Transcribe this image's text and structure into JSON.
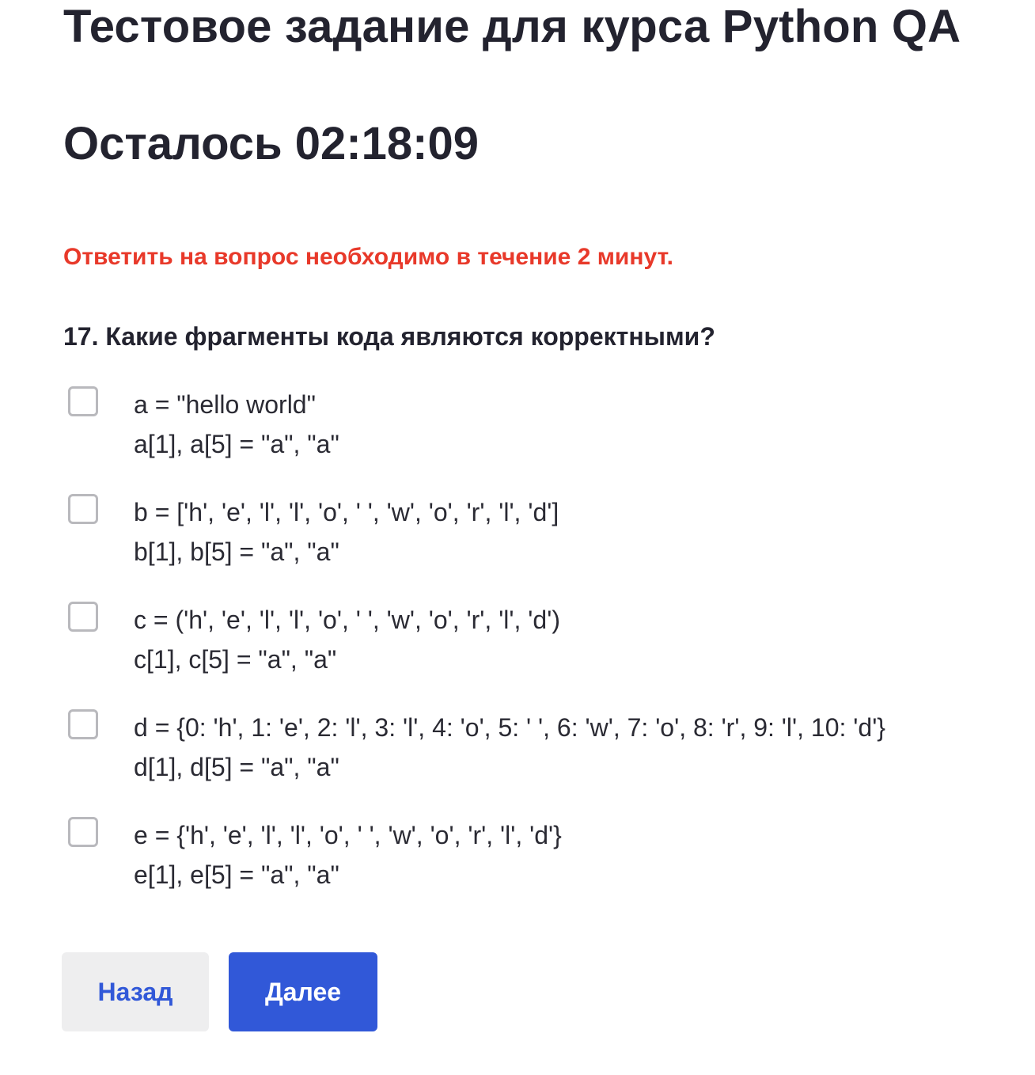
{
  "header": {
    "title": "Тестовое задание для курса Python QA",
    "timer": "Осталось 02:18:09"
  },
  "warning": "Ответить на вопрос необходимо в течение 2 минут.",
  "question": {
    "text": "17. Какие фрагменты кода являются корректными?",
    "options": [
      {
        "line1": "a = \"hello world\"",
        "line2": "a[1], a[5] = \"a\", \"a\"",
        "checked": false
      },
      {
        "line1": "b = ['h', 'e', 'l', 'l', 'o', ' ', 'w', 'o', 'r', 'l', 'd']",
        "line2": "b[1], b[5] = \"a\", \"a\"",
        "checked": false
      },
      {
        "line1": "c = ('h', 'e', 'l', 'l', 'o', ' ', 'w', 'o', 'r', 'l', 'd')",
        "line2": "c[1], c[5] = \"a\", \"a\"",
        "checked": false
      },
      {
        "line1": "d = {0: 'h', 1: 'e', 2: 'l', 3: 'l', 4: 'o', 5: ' ', 6: 'w', 7: 'o', 8: 'r', 9: 'l', 10: 'd'}",
        "line2": "d[1], d[5] = \"a\", \"a\"",
        "checked": false
      },
      {
        "line1": "e = {'h', 'e', 'l', 'l', 'o', ' ', 'w', 'o', 'r', 'l', 'd'}",
        "line2": "e[1], e[5] = \"a\", \"a\"",
        "checked": false
      }
    ]
  },
  "navigation": {
    "back_label": "Назад",
    "next_label": "Далее"
  },
  "colors": {
    "text": "#23232f",
    "warning": "#e8392a",
    "accent": "#3158d8",
    "secondary_button_bg": "#eeeeef",
    "checkbox_border": "#b9b9bd"
  }
}
